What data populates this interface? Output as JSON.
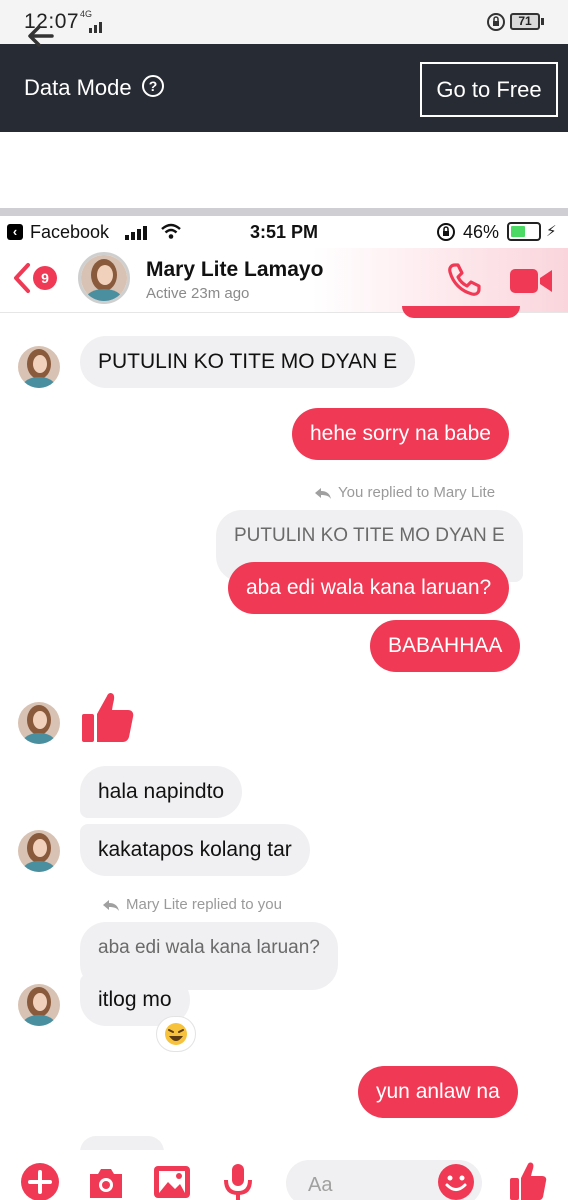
{
  "outer_status": {
    "time": "12:07",
    "network": "4G",
    "battery": "71"
  },
  "data_mode": {
    "label": "Data Mode",
    "help_icon": "question-circle-icon",
    "go_free_label": "Go to Free"
  },
  "nav": {
    "back_icon": "back-arrow-icon"
  },
  "inner_status": {
    "app": "Facebook",
    "time": "3:51 PM",
    "battery_pct": "46%"
  },
  "chat_header": {
    "name": "Mary Lite Lamayo",
    "status": "Active 23m ago",
    "unread_count": "9"
  },
  "messages": {
    "m1": "PUTULIN KO TITE MO DYAN E",
    "m2": "hehe sorry na babe",
    "reply_note_1": "You replied to Mary Lite",
    "quote_1": "PUTULIN KO TITE MO DYAN E",
    "m3": "aba edi wala kana laruan?",
    "m4": "BABAHHAA",
    "m5": "hala napindto",
    "m6": "kakatapos kolang tar",
    "reply_note_2": "Mary Lite replied to you",
    "quote_2": "aba edi wala kana laruan?",
    "m7": "itlog mo",
    "m8": "yun anlaw na"
  },
  "composer": {
    "placeholder": "Aa"
  },
  "colors": {
    "accent": "#f03a55",
    "dark_bar": "#272b33",
    "incoming_bubble": "#f0f0f2"
  }
}
